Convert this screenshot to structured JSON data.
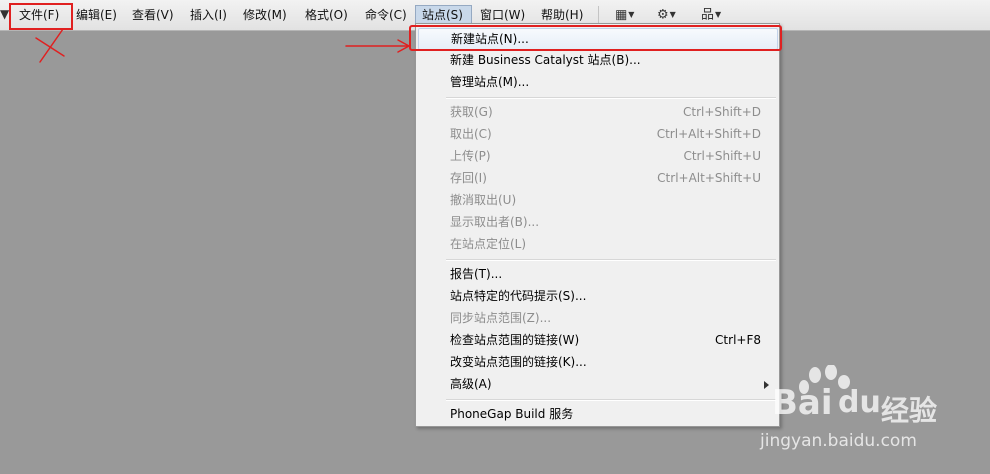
{
  "menubar": {
    "edge_glyph": "▼",
    "items": [
      {
        "label": "文件(F)"
      },
      {
        "label": "编辑(E)"
      },
      {
        "label": "查看(V)"
      },
      {
        "label": "插入(I)"
      },
      {
        "label": "修改(M)"
      },
      {
        "label": "格式(O)"
      },
      {
        "label": "命令(C)"
      },
      {
        "label": "站点(S)",
        "active": true
      },
      {
        "label": "窗口(W)"
      },
      {
        "label": "帮助(H)"
      }
    ],
    "tools": [
      {
        "icon": "layout-icon",
        "glyph": "▦"
      },
      {
        "icon": "gear-icon",
        "glyph": "⚙"
      },
      {
        "icon": "site-map-icon",
        "glyph": "品"
      }
    ]
  },
  "site_menu": {
    "groups": [
      [
        {
          "label": "新建站点(N)...",
          "shortcut": "",
          "enabled": true,
          "highlighted": true
        },
        {
          "label": "新建 Business Catalyst 站点(B)...",
          "shortcut": "",
          "enabled": true
        },
        {
          "label": "管理站点(M)...",
          "shortcut": "",
          "enabled": true
        }
      ],
      [
        {
          "label": "获取(G)",
          "shortcut": "Ctrl+Shift+D",
          "enabled": false
        },
        {
          "label": "取出(C)",
          "shortcut": "Ctrl+Alt+Shift+D",
          "enabled": false
        },
        {
          "label": "上传(P)",
          "shortcut": "Ctrl+Shift+U",
          "enabled": false
        },
        {
          "label": "存回(I)",
          "shortcut": "Ctrl+Alt+Shift+U",
          "enabled": false
        },
        {
          "label": "撤消取出(U)",
          "shortcut": "",
          "enabled": false
        },
        {
          "label": "显示取出者(B)...",
          "shortcut": "",
          "enabled": false
        },
        {
          "label": "在站点定位(L)",
          "shortcut": "",
          "enabled": false
        }
      ],
      [
        {
          "label": "报告(T)...",
          "shortcut": "",
          "enabled": true
        },
        {
          "label": "站点特定的代码提示(S)...",
          "shortcut": "",
          "enabled": true
        },
        {
          "label": "同步站点范围(Z)...",
          "shortcut": "",
          "enabled": false
        },
        {
          "label": "检查站点范围的链接(W)",
          "shortcut": "Ctrl+F8",
          "enabled": true
        },
        {
          "label": "改变站点范围的链接(K)...",
          "shortcut": "",
          "enabled": true
        },
        {
          "label": "高级(A)",
          "shortcut": "",
          "enabled": true,
          "submenu": true
        }
      ],
      [
        {
          "label": "PhoneGap Build 服务",
          "shortcut": "",
          "enabled": true
        }
      ]
    ]
  },
  "watermark": {
    "brand_left": "Bai",
    "brand_right": "du",
    "brand_cn": "经验",
    "url": "jingyan.baidu.com"
  },
  "colors": {
    "annotation_red": "#e02020",
    "background": "#999999"
  }
}
